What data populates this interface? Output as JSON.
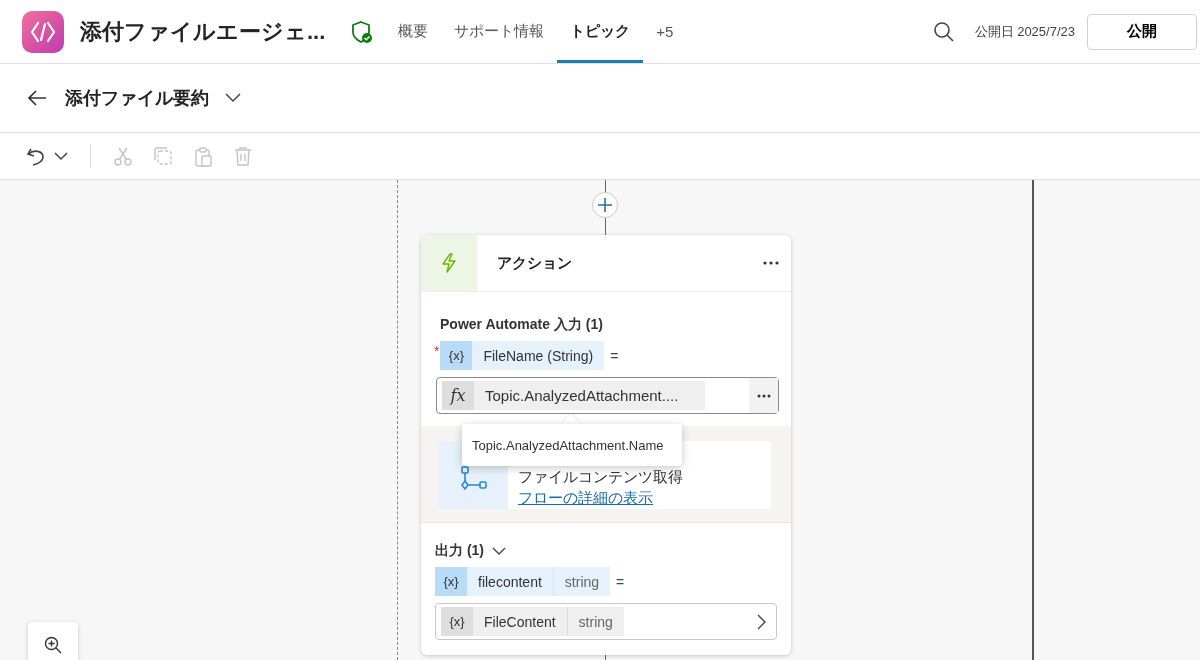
{
  "app": {
    "name": "添付ファイルエージェ...",
    "tabs": [
      {
        "label": "概要",
        "selected": false
      },
      {
        "label": "サポート情報",
        "selected": false
      },
      {
        "label": "トピック",
        "selected": true
      },
      {
        "label": "+5",
        "selected": false
      }
    ],
    "published": "公開日 2025/7/23",
    "publish_button": "公開"
  },
  "topic": {
    "title": "添付ファイル要約"
  },
  "toolbar": [
    {
      "kind": "undo",
      "disabled": false
    },
    {
      "kind": "cut",
      "disabled": true
    },
    {
      "kind": "copy",
      "disabled": true
    },
    {
      "kind": "paste",
      "disabled": true
    },
    {
      "kind": "delete",
      "disabled": true
    }
  ],
  "action_card": {
    "title": "アクション",
    "inputs_heading": "Power Automate 入力 (1)",
    "input": {
      "required": true,
      "required_mark": "*",
      "var_icon": "{x}",
      "name": "FileName (String)",
      "equals": "=",
      "formula_icon": "fx",
      "value": "Topic.AnalyzedAttachment...."
    },
    "tooltip": "Topic.AnalyzedAttachment.Name",
    "flow": {
      "name": "ファイルコンテンツ取得",
      "link": "フローの詳細の表示"
    },
    "outputs_heading": "出力 (1)",
    "output": {
      "var_icon": "{x}",
      "name": "filecontent",
      "type": "string",
      "equals": "=",
      "target_icon": "{x}",
      "target_name": "FileContent",
      "target_type": "string"
    }
  }
}
